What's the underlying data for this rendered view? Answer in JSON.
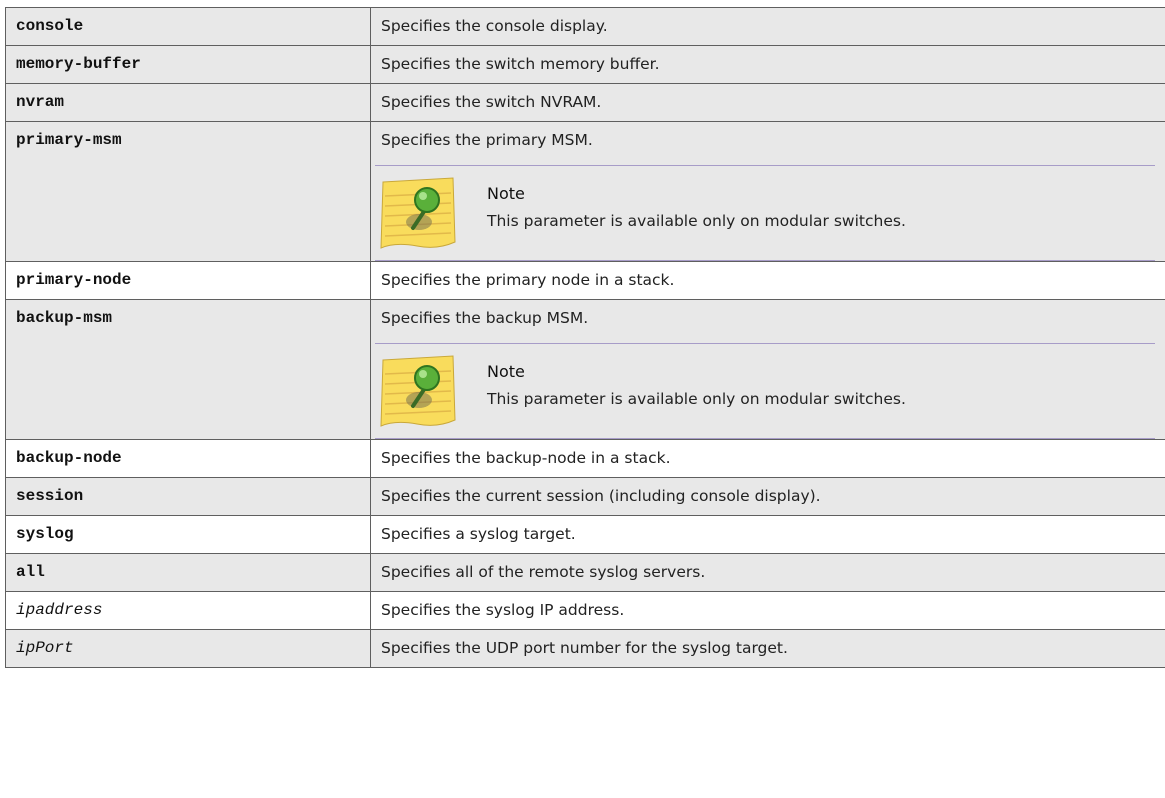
{
  "rows": [
    {
      "param": "console",
      "desc": "Specifies the console display."
    },
    {
      "param": "memory-buffer",
      "desc": "Specifies the switch memory buffer."
    },
    {
      "param": "nvram",
      "desc": "Specifies the switch NVRAM."
    },
    {
      "param": "primary-msm",
      "desc": "Specifies the primary MSM.",
      "note_title": "Note",
      "note_text": "This parameter is available only on modular switches."
    },
    {
      "param": "primary-node",
      "desc": "Specifies the primary node in a stack."
    },
    {
      "param": "backup-msm",
      "desc": "Specifies the backup MSM.",
      "note_title": "Note",
      "note_text": "This parameter is available only on modular switches."
    },
    {
      "param": "backup-node",
      "desc": "Specifies the backup-node in a stack."
    },
    {
      "param": "session",
      "desc": "Specifies the current session (including console display)."
    },
    {
      "param": "syslog",
      "desc": "Specifies a syslog target."
    },
    {
      "param": "all",
      "desc": "Specifies all of the remote syslog servers."
    },
    {
      "param": "ipaddress",
      "desc": "Specifies the syslog IP address."
    },
    {
      "param": "ipPort",
      "desc": "Specifies the UDP port number for the syslog target."
    }
  ],
  "note_icon": "sticky-note-pin-icon"
}
